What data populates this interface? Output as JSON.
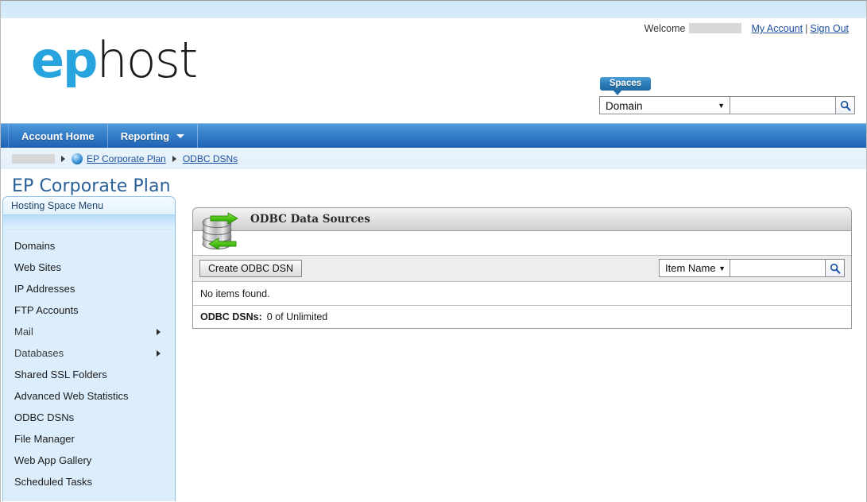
{
  "brand": {
    "logo_prefix": "ep",
    "logo_suffix": "host",
    "accent_color": "#27a3dd",
    "link_color": "#1c4f9c",
    "nav_color": "#2f7fc8"
  },
  "header": {
    "welcome_label": "Welcome",
    "my_account_label": "My Account",
    "separator": "|",
    "sign_out_label": "Sign Out",
    "spaces_tab_label": "Spaces",
    "search": {
      "scope_value": "Domain",
      "caret_glyph": "▼",
      "query_value": "",
      "query_placeholder": "",
      "search_icon": "search-icon"
    }
  },
  "nav": {
    "items": [
      {
        "label": "Account Home",
        "has_dropdown": false
      },
      {
        "label": "Reporting",
        "has_dropdown": true
      }
    ]
  },
  "breadcrumb": {
    "items": [
      {
        "label": "",
        "redacted": true,
        "link": false,
        "icon": null
      },
      {
        "label": "EP Corporate Plan",
        "redacted": false,
        "link": true,
        "icon": "globe-icon"
      },
      {
        "label": "ODBC DSNs",
        "redacted": false,
        "link": true,
        "icon": null
      }
    ]
  },
  "page": {
    "title": "EP Corporate Plan"
  },
  "sidebar": {
    "title": "Hosting Space Menu",
    "items": [
      {
        "label": "Domains",
        "has_submenu": false
      },
      {
        "label": "Web Sites",
        "has_submenu": false
      },
      {
        "label": "IP Addresses",
        "has_submenu": false
      },
      {
        "label": "FTP Accounts",
        "has_submenu": false
      },
      {
        "label": "Mail",
        "has_submenu": true
      },
      {
        "label": "Databases",
        "has_submenu": true
      },
      {
        "label": "Shared SSL Folders",
        "has_submenu": false
      },
      {
        "label": "Advanced Web Statistics",
        "has_submenu": false
      },
      {
        "label": "ODBC DSNs",
        "has_submenu": false
      },
      {
        "label": "File Manager",
        "has_submenu": false
      },
      {
        "label": "Web App Gallery",
        "has_submenu": false
      },
      {
        "label": "Scheduled Tasks",
        "has_submenu": false
      }
    ]
  },
  "panel": {
    "title": "ODBC Data Sources",
    "icon": "database-sync-icon",
    "create_button_label": "Create ODBC DSN",
    "search": {
      "scope_value": "Item Name",
      "caret_glyph": "▼",
      "query_value": "",
      "query_placeholder": "",
      "search_icon": "search-icon"
    },
    "empty_message": "No items found.",
    "footer": {
      "label": "ODBC DSNs:",
      "value": "0 of Unlimited"
    }
  }
}
